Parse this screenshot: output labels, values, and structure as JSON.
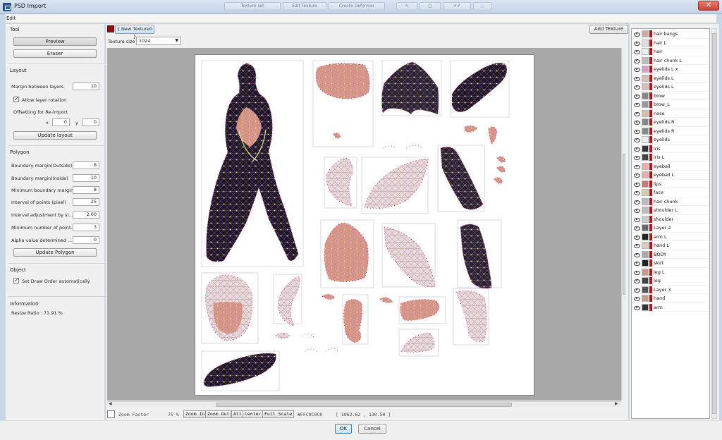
{
  "window": {
    "title": "PSD Import",
    "title_toolbar": [
      "Texture set",
      "Edit Texture",
      "Create Deformer"
    ]
  },
  "menu": {
    "edit": "Edit"
  },
  "tool": {
    "section": "Tool",
    "preview": "Preview",
    "eraser": "Eraser"
  },
  "layout": {
    "section": "Layout",
    "margin_label": "Margin between layers",
    "margin_value": "10",
    "allow_rotation": "Allow layer rotation",
    "allow_rotation_checked": true,
    "offset_label": "Offsetting for Re-import",
    "x_label": "x",
    "x_value": "0",
    "y_label": "y",
    "y_value": "0",
    "update_layout": "Update layout"
  },
  "polygon": {
    "section": "Polygon",
    "fields": [
      {
        "label": "Boundary margin(Outside)",
        "value": "6"
      },
      {
        "label": "Boundary margin(Inside)",
        "value": "10"
      },
      {
        "label": "Minimum boundary margin",
        "value": "8"
      },
      {
        "label": "Interval of points (pixel)",
        "value": "25"
      },
      {
        "label": "Interval adjustment by si...",
        "value": "2.00"
      },
      {
        "label": "Minimum number of point...",
        "value": "3"
      },
      {
        "label": "Alpha value determined ...",
        "value": "0"
      }
    ],
    "update_polygon": "Update Polygon"
  },
  "object": {
    "section": "Object",
    "draw_order": "Set Draw Order automatically",
    "draw_order_checked": true
  },
  "information": {
    "section": "Information",
    "resize_ratio": "Resize Ratio : 71.91 %"
  },
  "texture_tabs": {
    "active": "{ New Texture0 }",
    "add_texture": "Add Texture",
    "size_label": "Texture size",
    "size_value": "1024"
  },
  "status": {
    "zoom_label": "Zoom Factor",
    "zoom_value": "75 %",
    "zoom_in": "Zoom In",
    "zoom_out": "Zoom Out",
    "all": "All",
    "center": "Center",
    "full_scale": "Full Scale",
    "color_hex": "#FFC0C0C0",
    "coords": "[ 1062.62 ,  130.50 ]"
  },
  "layers": [
    "hair bangs",
    "hair L",
    "hair",
    "hair chunk L",
    "eyelids L x",
    "eyelids L",
    "eyelids L",
    "brow",
    "brow_L",
    "nose",
    "eyelids R",
    "eyelids R",
    "eyelids",
    "iris",
    "iris L",
    "eyeball",
    "eyeball L",
    "lips",
    "face",
    "hair chunk",
    "shoulder L",
    "shoulder",
    "Layer 2",
    "arm L",
    "hand L",
    "BODY",
    "skirt",
    "leg L",
    "leg",
    "Layer 3",
    "hand",
    "arm"
  ],
  "dialog": {
    "ok": "OK",
    "cancel": "Cancel"
  },
  "colors": {
    "mesh_point": "#e0146e",
    "mesh_edge": "#b070d0",
    "mesh_inner_point": "#e8e44a",
    "dark_part": "#1e1424",
    "skin_part": "#d69a86",
    "texture_tag": "#8b1212"
  }
}
